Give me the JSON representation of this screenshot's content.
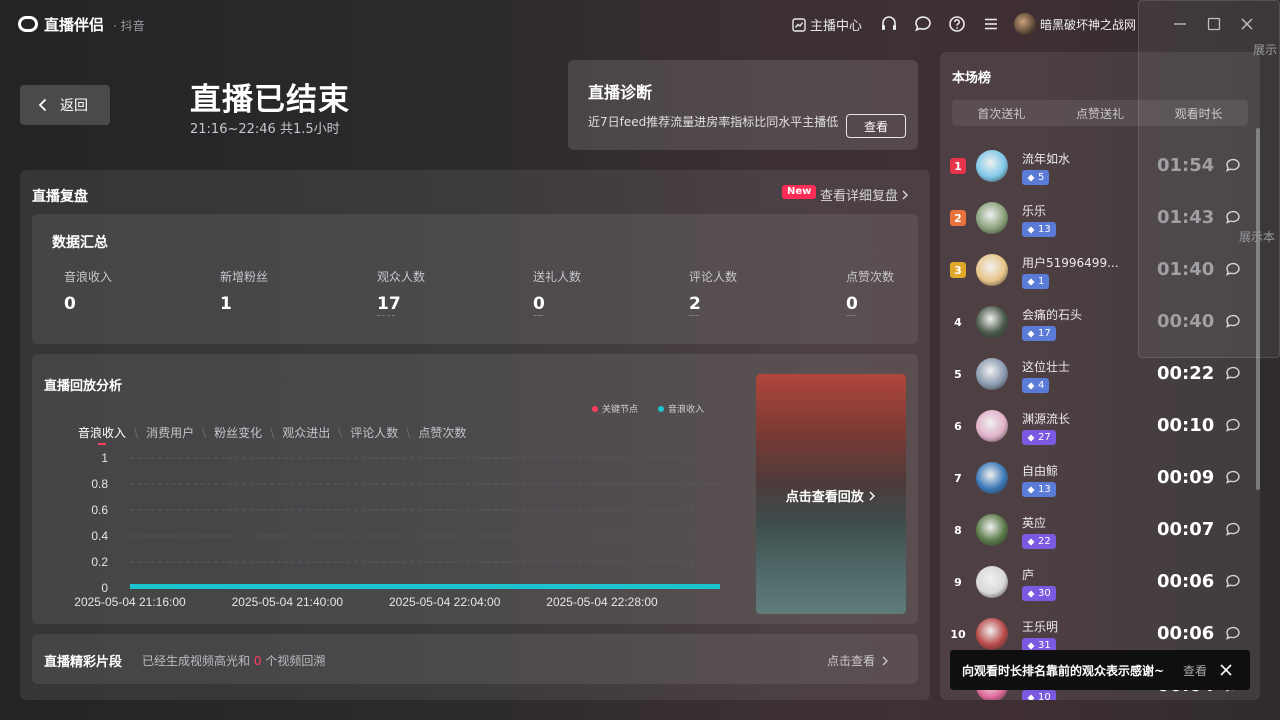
{
  "app": {
    "name": "直播伴侣",
    "sub": "· 抖音"
  },
  "titlebar": {
    "anchor_center": "主播中心",
    "username": "暗黑破坏神之战网"
  },
  "header": {
    "back_label": "返回",
    "title": "直播已结束",
    "time_range": "21:16~22:46 共1.5小时"
  },
  "diagnosis": {
    "title": "直播诊断",
    "text": "近7日feed推荐流量进房率指标比同水平主播低",
    "button": "查看"
  },
  "replay": {
    "title": "直播复盘",
    "new_badge": "New",
    "detail_link": "查看详细复盘",
    "summary": {
      "title": "数据汇总",
      "stats": [
        {
          "label": "音浪收入",
          "value": "0"
        },
        {
          "label": "新增粉丝",
          "value": "1"
        },
        {
          "label": "观众人数",
          "value": "17"
        },
        {
          "label": "送礼人数",
          "value": "0"
        },
        {
          "label": "评论人数",
          "value": "2"
        },
        {
          "label": "点赞次数",
          "value": "0"
        }
      ]
    },
    "analysis": {
      "title": "直播回放分析",
      "legend": [
        "关键节点",
        "音浪收入"
      ],
      "tabs": [
        "音浪收入",
        "消费用户",
        "粉丝变化",
        "观众进出",
        "评论人数",
        "点赞次数"
      ],
      "thumb_text": "点击查看回放"
    },
    "highlights": {
      "title": "直播精彩片段",
      "text_prefix": "已经生成视频高光和",
      "count": "0",
      "text_suffix": "个视频回溯",
      "link": "点击查看"
    }
  },
  "chart_data": {
    "type": "area",
    "title": "",
    "xlabel": "",
    "ylabel": "",
    "ylim": [
      0,
      1
    ],
    "y_ticks": [
      "1",
      "0.8",
      "0.6",
      "0.4",
      "0.2",
      "0"
    ],
    "x_ticks": [
      "2025-05-04 21:16:00",
      "2025-05-04 21:40:00",
      "2025-05-04 22:04:00",
      "2025-05-04 22:28:00"
    ],
    "series": [
      {
        "name": "音浪收入",
        "x": [
          "2025-05-04 21:16:00",
          "2025-05-04 22:46:00"
        ],
        "values": [
          0,
          0
        ],
        "color": "#1cc4d0"
      }
    ],
    "key_node_color": "#ff3b5c",
    "grid": true,
    "legend_position": "top-right"
  },
  "ranking": {
    "title": "本场榜",
    "tabs": [
      "首次送礼",
      "点赞送礼",
      "观看时长"
    ],
    "rows": [
      {
        "rank": "1",
        "name": "流年如水",
        "level": "5",
        "time": "01:54",
        "rank_color": "#e8344a",
        "badge_color": "#5a7bd8",
        "avatar": "#7fc8e8"
      },
      {
        "rank": "2",
        "name": "乐乐",
        "level": "13",
        "time": "01:43",
        "rank_color": "#e8733a",
        "badge_color": "#5a7bd8",
        "avatar": "#8aa07a"
      },
      {
        "rank": "3",
        "name": "用户51996499...",
        "level": "1",
        "time": "01:40",
        "rank_color": "#e0a828",
        "badge_color": "#5a7bd8",
        "avatar": "#e8c488"
      },
      {
        "rank": "4",
        "name": "会痛的石头",
        "level": "17",
        "time": "00:40",
        "rank_color": "",
        "badge_color": "#5a7bd8",
        "avatar": "#4a5a48"
      },
      {
        "rank": "5",
        "name": "这位壮士",
        "level": "4",
        "time": "00:22",
        "rank_color": "",
        "badge_color": "#5a7bd8",
        "avatar": "#8a9ab0"
      },
      {
        "rank": "6",
        "name": "渊源流长",
        "level": "27",
        "time": "00:10",
        "rank_color": "",
        "badge_color": "#7a5ae0",
        "avatar": "#e0b0c8"
      },
      {
        "rank": "7",
        "name": "自由鲸",
        "level": "13",
        "time": "00:09",
        "rank_color": "",
        "badge_color": "#5a7bd8",
        "avatar": "#3a78b8"
      },
      {
        "rank": "8",
        "name": "英应",
        "level": "22",
        "time": "00:07",
        "rank_color": "",
        "badge_color": "#7a5ae0",
        "avatar": "#5a7a48"
      },
      {
        "rank": "9",
        "name": "庐",
        "level": "30",
        "time": "00:06",
        "rank_color": "",
        "badge_color": "#7a5ae0",
        "avatar": "#d8d8d8"
      },
      {
        "rank": "10",
        "name": "王乐明",
        "level": "31",
        "time": "00:06",
        "rank_color": "",
        "badge_color": "#7a5ae0",
        "avatar": "#b84848"
      },
      {
        "rank": "11",
        "name": "",
        "level": "10",
        "time": "00:04",
        "rank_color": "",
        "badge_color": "#7a5ae0",
        "avatar": "#e06a9a"
      }
    ]
  },
  "overlay": {
    "text1": "展示",
    "text2": "展示本"
  },
  "toast": {
    "text": "向观看时长排名靠前的观众表示感谢~",
    "view": "查看"
  }
}
